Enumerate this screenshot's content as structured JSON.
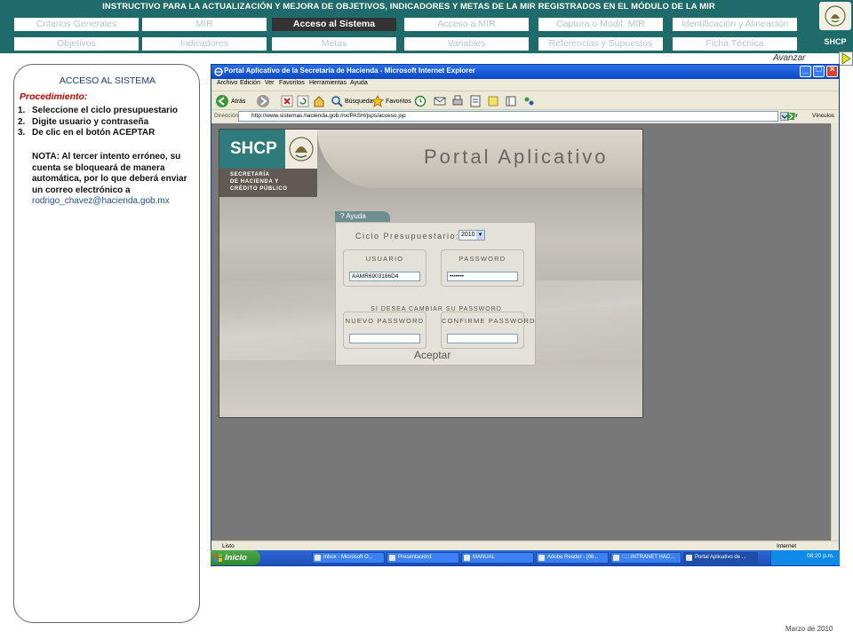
{
  "header": {
    "title": "INSTRUCTIVO PARA  LA ACTUALIZACIÓN Y MEJORA DE OBJETIVOS, INDICADORES Y METAS DE LA MIR REGISTRADOS EN EL MÓDULO DE LA MIR",
    "logo_text": "SHCP",
    "nav_row1": [
      "Criterios Generales",
      "MIR",
      "Acceso al Sistema",
      "Acceso a MIR",
      "Captura o Modif. MIR",
      "Identificación y Alineación"
    ],
    "nav_row2": [
      "Objetivos",
      "Indicadores",
      "Metas",
      "Variables",
      "Referencias y Supuestos",
      "Ficha Técnica"
    ],
    "active_tab": "Acceso al Sistema"
  },
  "nav": {
    "avanzar_label": "Avanzar"
  },
  "left_panel": {
    "title": "ACCESO AL SISTEMA",
    "procedure_title": "Procedimiento:",
    "steps": [
      {
        "num": "1.",
        "text": "Seleccione el ciclo presupuestario"
      },
      {
        "num": "2.",
        "text": "Digite usuario y contraseña"
      },
      {
        "num": "3.",
        "text": "De clic en el botón ACEPTAR"
      }
    ],
    "note": "NOTA: Al tercer intento erróneo, su cuenta se bloqueará de manera automática, por lo que deberá enviar un correo electrónico a",
    "email": "rodrigo_chavez@hacienda.gob.mx"
  },
  "browser": {
    "title": "Portal Aplicativo de la Secretaría de Hacienda - Microsoft Internet Explorer",
    "menu": [
      "Archivo",
      "Edición",
      "Ver",
      "Favoritos",
      "Herramientas",
      "Ayuda"
    ],
    "toolbar": {
      "back": "Atrás",
      "search": "Búsqueda",
      "favorites": "Favoritos"
    },
    "address_label": "Dirección",
    "address": "http://www.sistemas.hacienda.gob.mx/PASH/jsps/acceso.jsp",
    "go": "Ir",
    "links": "Vínculos",
    "status": "Listo",
    "zone": "Internet"
  },
  "portal": {
    "logo": "SHCP",
    "secretaria": [
      "SECRETARÍA",
      "DE HACIENDA Y",
      "CRÉDITO PÚBLICO"
    ],
    "title": "Portal Aplicativo",
    "help_tab": "? Ayuda",
    "ciclo_label": "Ciclo Presupuestario:",
    "ciclo_value": "2010",
    "usuario_label": "USUARIO",
    "usuario_value": "AAMR6903186D4",
    "password_label": "PASSWORD",
    "password_value": "•••••••",
    "change_label": "SI DESEA CAMBIAR SU PASSWORD",
    "new_password_label": "NUEVO PASSWORD",
    "confirm_password_label": "CONFIRME PASSWORD",
    "submit_label": "Aceptar"
  },
  "taskbar": {
    "start": "Inicio",
    "tasks": [
      "Inbox - Microsoft O...",
      "Presentación1",
      "MANUAL",
      "Adobe Reader - [08...",
      "::::::INTRANET HAC...",
      "Portal Aplicativo de ..."
    ],
    "active_task": "Portal Aplicativo de ...",
    "clock": "08:20 p.m."
  },
  "footer": {
    "date": "Marzo de 2010"
  },
  "colors": {
    "banner": "#1f6a6a",
    "active_tab": "#333333",
    "procedure_red": "#cc0000",
    "email_blue": "#1f4fa0"
  },
  "icons": [
    "mexico-emblem-icon",
    "avanzar-arrow-icon",
    "ie-icon",
    "back-icon",
    "forward-icon",
    "stop-icon",
    "refresh-icon",
    "home-icon",
    "search-icon",
    "favorites-icon",
    "history-icon",
    "mail-icon",
    "print-icon",
    "edit-icon",
    "go-icon",
    "dropdown-arrow-icon",
    "windows-flag-icon"
  ]
}
